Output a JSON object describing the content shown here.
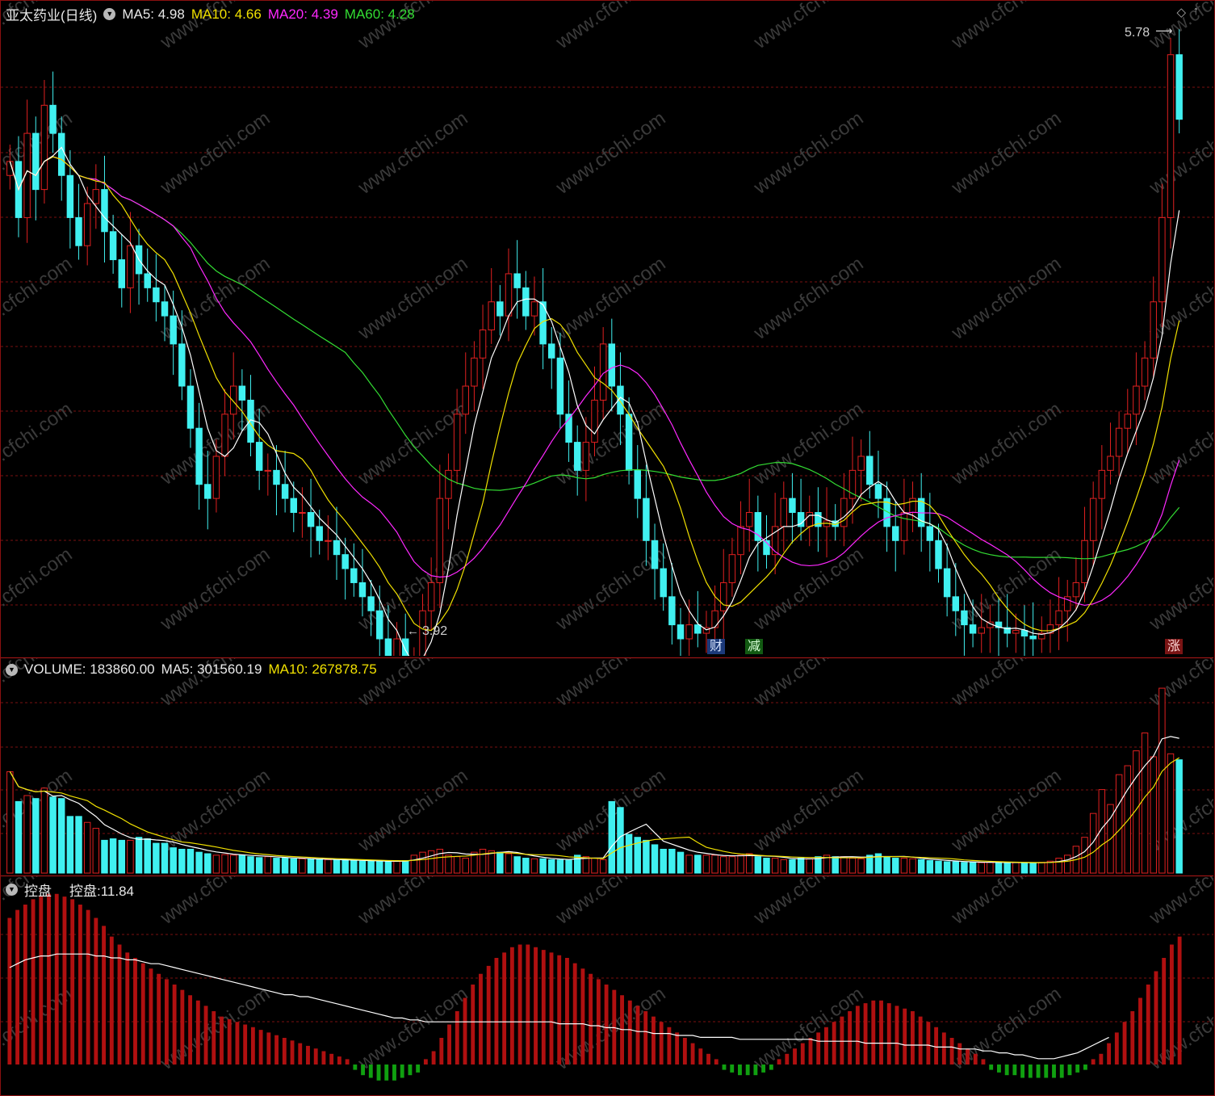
{
  "price_panel": {
    "stock_name": "亚太药业(日线)",
    "ma5_label": "MA5:",
    "ma5_value": "4.98",
    "ma10_label": "MA10:",
    "ma10_value": "4.66",
    "ma20_label": "MA20:",
    "ma20_value": "4.39",
    "ma60_label": "MA60:",
    "ma60_value": "4.28",
    "high_marker": "5.78",
    "low_marker": "3.92",
    "event_tags": [
      "财",
      "减",
      "涨"
    ]
  },
  "volume_panel": {
    "label": "VOLUME:",
    "value": "183860.00",
    "ma5_label": "MA5:",
    "ma5_value": "301560.19",
    "ma10_label": "MA10:",
    "ma10_value": "267878.75"
  },
  "control_panel": {
    "title": "控盘",
    "label": "控盘:",
    "value": "11.84"
  },
  "watermark": "www.cfchi.com",
  "colors": {
    "up": "#e02020",
    "down": "#40f0f0",
    "ma5": "#ffffff",
    "ma10": "#f0e000",
    "ma20": "#ff28ff",
    "ma60": "#33dd33",
    "grid": "#7a1010",
    "bar_pos": "#b01010",
    "bar_neg": "#10a010"
  },
  "icons": [
    "collapse-toggle-icon",
    "diamond-icon",
    "arrow-right-icon"
  ],
  "chart_data": [
    {
      "type": "candlestick",
      "title": "亚太药业(日线)",
      "ylim": [
        3.7,
        5.9
      ],
      "high": 5.78,
      "low": 3.92,
      "closes": [
        5.4,
        5.2,
        5.5,
        5.3,
        5.6,
        5.5,
        5.35,
        5.2,
        5.1,
        5.25,
        5.3,
        5.15,
        5.05,
        4.95,
        5.1,
        5.0,
        4.95,
        4.9,
        4.85,
        4.75,
        4.6,
        4.45,
        4.25,
        4.2,
        4.35,
        4.5,
        4.6,
        4.55,
        4.4,
        4.3,
        4.3,
        4.25,
        4.2,
        4.15,
        4.15,
        4.1,
        4.05,
        4.05,
        4.0,
        3.95,
        3.9,
        3.85,
        3.8,
        3.7,
        3.6,
        3.7,
        3.5,
        3.55,
        3.8,
        3.9,
        4.2,
        4.3,
        4.5,
        4.6,
        4.7,
        4.8,
        4.9,
        4.85,
        5.0,
        4.95,
        4.85,
        4.9,
        4.75,
        4.7,
        4.5,
        4.4,
        4.3,
        4.4,
        4.55,
        4.75,
        4.6,
        4.5,
        4.3,
        4.2,
        4.05,
        3.95,
        3.85,
        3.75,
        3.7,
        3.75,
        3.72,
        3.74,
        3.8,
        3.9,
        4.0,
        4.1,
        4.15,
        4.05,
        4.0,
        4.1,
        4.2,
        4.15,
        4.1,
        4.15,
        4.1,
        4.12,
        4.1,
        4.2,
        4.3,
        4.35,
        4.25,
        4.2,
        4.1,
        4.05,
        4.15,
        4.2,
        4.1,
        4.05,
        3.95,
        3.85,
        3.8,
        3.75,
        3.72,
        3.74,
        3.76,
        3.74,
        3.72,
        3.73,
        3.71,
        3.7,
        3.72,
        3.75,
        3.8,
        3.85,
        3.9,
        4.05,
        4.2,
        4.3,
        4.35,
        4.45,
        4.5,
        4.6,
        4.7,
        4.9,
        5.2,
        5.78,
        5.55
      ],
      "series": [
        {
          "name": "MA5",
          "value": 4.98
        },
        {
          "name": "MA10",
          "value": 4.66
        },
        {
          "name": "MA20",
          "value": 4.39
        },
        {
          "name": "MA60",
          "value": 4.28
        }
      ]
    },
    {
      "type": "bar",
      "title": "VOLUME",
      "values": [
        340,
        240,
        260,
        250,
        285,
        255,
        250,
        190,
        190,
        170,
        150,
        110,
        115,
        110,
        110,
        120,
        115,
        100,
        100,
        85,
        80,
        80,
        70,
        65,
        60,
        62,
        60,
        60,
        55,
        52,
        55,
        50,
        50,
        48,
        48,
        46,
        45,
        45,
        44,
        42,
        42,
        40,
        40,
        40,
        38,
        40,
        42,
        60,
        70,
        75,
        80,
        60,
        55,
        50,
        70,
        80,
        75,
        70,
        65,
        55,
        50,
        48,
        48,
        45,
        44,
        43,
        60,
        55,
        50,
        45,
        240,
        220,
        130,
        120,
        110,
        95,
        80,
        80,
        70,
        60,
        60,
        60,
        60,
        55,
        55,
        60,
        65,
        55,
        50,
        50,
        45,
        45,
        50,
        48,
        55,
        60,
        55,
        55,
        50,
        48,
        60,
        65,
        55,
        50,
        50,
        48,
        45,
        42,
        40,
        38,
        38,
        36,
        36,
        35,
        36,
        36,
        35,
        35,
        34,
        34,
        36,
        40,
        50,
        60,
        90,
        120,
        200,
        280,
        230,
        330,
        360,
        410,
        470,
        390,
        620,
        400,
        380
      ],
      "series": [
        {
          "name": "MA5",
          "value": 301560.19
        },
        {
          "name": "MA10",
          "value": 267878.75
        }
      ],
      "current": 183860.0
    },
    {
      "type": "bar",
      "title": "控盘",
      "current": 11.84,
      "values": [
        55,
        58,
        60,
        62,
        63,
        64,
        64,
        63,
        62,
        60,
        58,
        55,
        52,
        48,
        45,
        42,
        40,
        38,
        36,
        34,
        32,
        30,
        28,
        26,
        24,
        22,
        20,
        18,
        17,
        16,
        15,
        14,
        13,
        12,
        11,
        10,
        9,
        8,
        7,
        6,
        5,
        4,
        3,
        2,
        -2,
        -4,
        -5,
        -6,
        -6,
        -6,
        -5,
        -4,
        -3,
        2,
        5,
        10,
        15,
        20,
        25,
        30,
        34,
        37,
        40,
        42,
        44,
        45,
        45,
        44,
        43,
        42,
        41,
        40,
        38,
        36,
        34,
        32,
        30,
        28,
        26,
        24,
        22,
        20,
        18,
        16,
        14,
        12,
        10,
        8,
        6,
        4,
        2,
        -2,
        -3,
        -4,
        -4,
        -4,
        -3,
        -2,
        2,
        4,
        6,
        8,
        10,
        12,
        14,
        16,
        18,
        20,
        22,
        23,
        24,
        24,
        23,
        22,
        21,
        20,
        18,
        16,
        14,
        12,
        10,
        8,
        6,
        4,
        2,
        -2,
        -3,
        -4,
        -4,
        -5,
        -5,
        -5,
        -5,
        -5,
        -5,
        -4,
        -3,
        -2,
        2,
        4,
        8,
        12,
        16,
        20,
        25,
        30,
        35,
        40,
        45,
        48
      ],
      "line": [
        50,
        52,
        54,
        55,
        56,
        56,
        57,
        57,
        57,
        57,
        57,
        56,
        56,
        55,
        55,
        54,
        54,
        53,
        52,
        52,
        51,
        50,
        49,
        48,
        47,
        46,
        45,
        44,
        43,
        42,
        41,
        40,
        39,
        38,
        37,
        36,
        36,
        35,
        35,
        34,
        33,
        32,
        31,
        30,
        29,
        28,
        27,
        26,
        25,
        24,
        24,
        23,
        23,
        22,
        22,
        22,
        22,
        22,
        22,
        22,
        22,
        22,
        22,
        22,
        22,
        22,
        22,
        22,
        22,
        22,
        21,
        21,
        21,
        21,
        20,
        20,
        19,
        19,
        18,
        18,
        17,
        17,
        16,
        16,
        16,
        15,
        15,
        15,
        14,
        14,
        14,
        14,
        14,
        13,
        13,
        13,
        13,
        13,
        13,
        13,
        13,
        13,
        13,
        12,
        12,
        12,
        12,
        12,
        12,
        11,
        11,
        11,
        11,
        11,
        10,
        10,
        10,
        10,
        9,
        9,
        9,
        8,
        8,
        8,
        7,
        7,
        6,
        6,
        5,
        5,
        4,
        3,
        3,
        3,
        4,
        5,
        6,
        8,
        10,
        12,
        14
      ]
    }
  ]
}
